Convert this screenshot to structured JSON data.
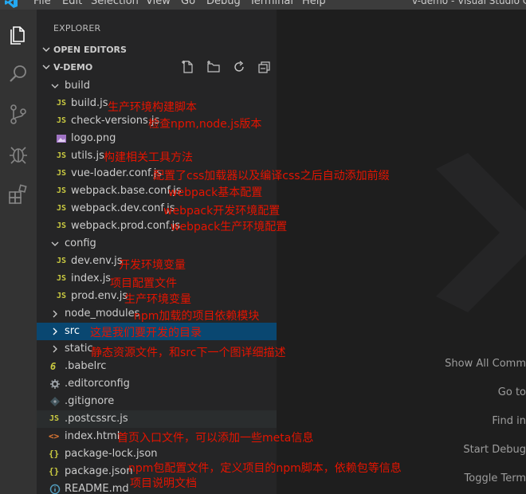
{
  "menubar": {
    "items": [
      "File",
      "Edit",
      "Selection",
      "View",
      "Go",
      "Debug",
      "Terminal",
      "Help"
    ],
    "window_title": "v-demo - Visual Studio Code"
  },
  "sidebar": {
    "title": "EXPLORER",
    "open_editors": "OPEN EDITORS",
    "project": "V-DEMO"
  },
  "tree": {
    "build": "build",
    "build_js": "build.js",
    "check_versions": "check-versions.js",
    "logo": "logo.png",
    "utils": "utils.js",
    "vue_loader": "vue-loader.conf.js",
    "webpack_base": "webpack.base.conf.js",
    "webpack_dev": "webpack.dev.conf.js",
    "webpack_prod": "webpack.prod.conf.js",
    "config": "config",
    "dev_env": "dev.env.js",
    "index_js": "index.js",
    "prod_env": "prod.env.js",
    "node_modules": "node_modules",
    "src": "src",
    "static": "static",
    "babelrc": ".babelrc",
    "editorconfig": ".editorconfig",
    "gitignore": ".gitignore",
    "postcssrc": ".postcssrc.js",
    "index_html": "index.html",
    "package_lock": "package-lock.json",
    "package_json": "package.json",
    "readme": "README.md"
  },
  "annotations": {
    "build_js": "生产环境构建脚本",
    "check_versions": "检查npm,node.js版本",
    "utils": "构建相关工具方法",
    "vue_loader": "配置了css加载器以及编译css之后自动添加前缀",
    "webpack_base": "webpack基本配置",
    "webpack_dev": "webpack开发环境配置",
    "webpack_prod": "webpack生产环境配置",
    "dev_env": "开发环境变量",
    "index_js": "项目配置文件",
    "prod_env": "生产环境变量",
    "node_modules": "npm加载的项目依赖模块",
    "src": "这是我们要开发的目录",
    "static": "静态资源文件，和src下一个图详细描述",
    "index_html": "首页入口文件，可以添加一些meta信息",
    "package_json": "npm包配置文件，定义项目的npm脚本，依赖包等信息",
    "readme": "项目说明文档"
  },
  "editor_hints": {
    "show_all": "Show All Comm",
    "goto": "Go to",
    "find": "Find in",
    "debug": "Start Debug",
    "toggle": "Toggle Term"
  },
  "icons": {
    "files": "files-icon",
    "search": "search-icon",
    "scm": "source-control-icon",
    "debug": "debug-icon",
    "extensions": "extensions-icon"
  },
  "colors": {
    "annotation": "#e51400",
    "selection": "#094771",
    "accent": "#007acc"
  }
}
